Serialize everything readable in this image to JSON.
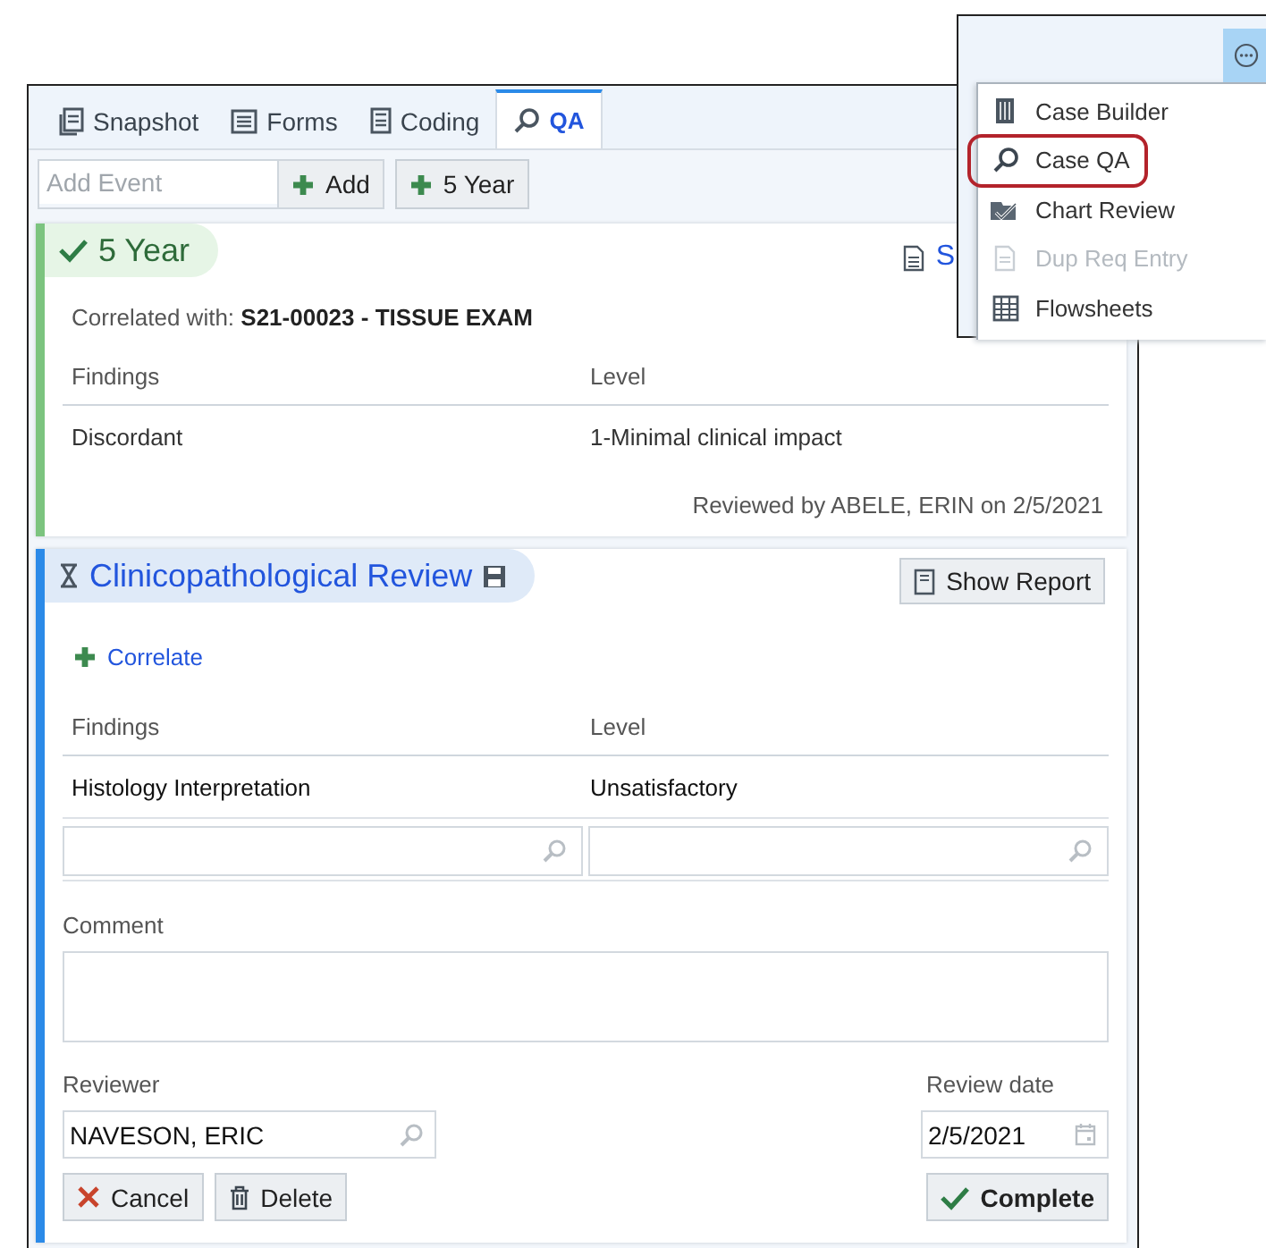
{
  "tabs": [
    {
      "label": "Snapshot",
      "kind": "snapshot",
      "selected": false
    },
    {
      "label": "Forms",
      "kind": "forms",
      "selected": false
    },
    {
      "label": "Coding",
      "kind": "coding",
      "selected": false
    },
    {
      "label": "QA",
      "kind": "qa",
      "selected": true
    }
  ],
  "toolbar": {
    "event_field": {
      "placeholder": "Add Event"
    },
    "add_button": "Add",
    "quick_button": "5 Year"
  },
  "completed_event": {
    "kind": "complete",
    "title": "5 Year",
    "link": "S",
    "correlated": "Correlated with: **S21-00023 - TISSUE EXAM**",
    "columns": [
      "Findings",
      "Level"
    ],
    "rows": [
      {
        "finding": "Discordant",
        "grade": "1-Minimal clinical impact"
      }
    ],
    "reviewed": "Reviewed by ABELE, ERIN on 2/5/2021"
  },
  "review_event": {
    "kind": "pending",
    "title": "Clinicopathological Review",
    "report_button": "Show Report",
    "correlate_link": "Correlate",
    "columns": [
      "Findings",
      "Level"
    ],
    "rows": [
      {
        "finding": "Histology Interpretation",
        "grade": "Unsatisfactory"
      }
    ],
    "comment_label": "Comment",
    "reviewer_label": "Reviewer",
    "reviewer_value": "NAVESON, ERIC",
    "date_label": "Review date",
    "date_value": "2/5/2021",
    "buttons": [
      {
        "label": "Cancel",
        "kind": "cancel"
      },
      {
        "label": "Delete",
        "kind": "delete"
      },
      {
        "label": "Complete",
        "kind": "complete"
      }
    ]
  },
  "menu": {
    "items": [
      {
        "label": "Case Builder",
        "kind": "builder",
        "highlighted": false,
        "disabled": false
      },
      {
        "label": "Case QA",
        "kind": "qa",
        "highlighted": true,
        "disabled": false
      },
      {
        "label": "Chart Review",
        "kind": "chart",
        "highlighted": false,
        "disabled": false
      },
      {
        "label": "Dup Req Entry",
        "kind": "dup",
        "highlighted": false,
        "disabled": true
      },
      {
        "label": "Flowsheets",
        "kind": "sheets",
        "highlighted": false,
        "disabled": false
      }
    ]
  }
}
